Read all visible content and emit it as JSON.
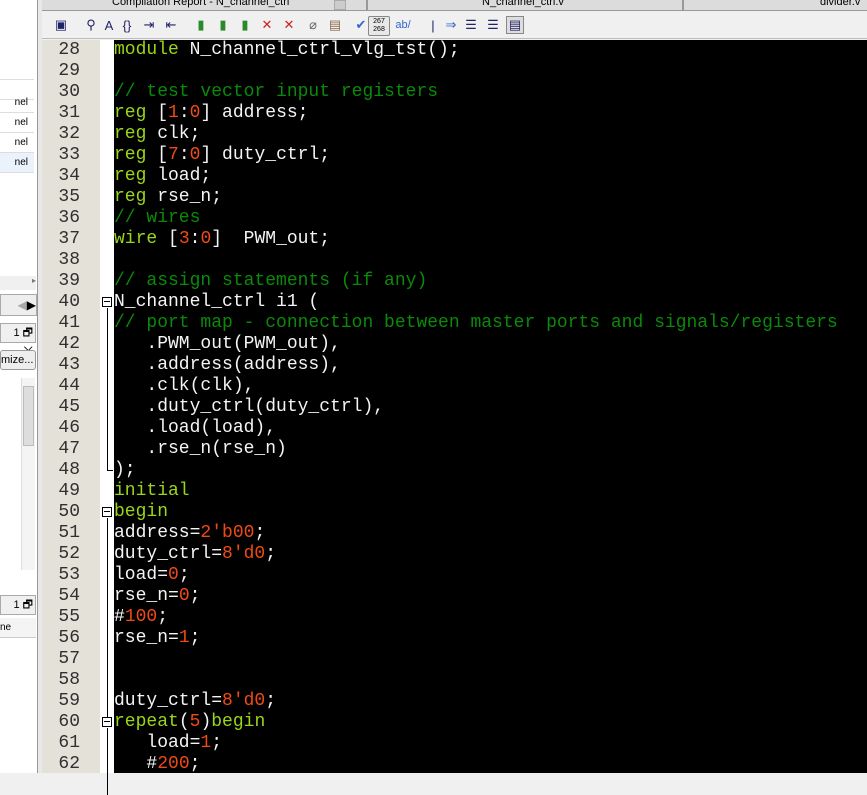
{
  "tabs": [
    {
      "label": "Compilation Report - N_channel_ctrl"
    },
    {
      "label": "N_channel_ctrl.v"
    },
    {
      "label": "divider.v"
    }
  ],
  "left_panel": {
    "items": [
      "nel",
      "nel",
      "nel",
      "nel"
    ],
    "pane_controls": "1 🗗 ✕",
    "customize_button": "mize...",
    "col_header": "ne"
  },
  "toolbar": {
    "line_number_badge": "267\n268",
    "replace_label": "ab/"
  },
  "colors": {
    "keyword": "#99d61a",
    "comment": "#0a8a0a",
    "number": "#f04a14",
    "text": "#f4f4f4"
  },
  "code": [
    {
      "n": "28",
      "t": [
        [
          "k",
          "module"
        ],
        [
          "t",
          " N_channel_ctrl_vlg_tst();"
        ]
      ]
    },
    {
      "n": "29",
      "t": []
    },
    {
      "n": "30",
      "t": [
        [
          "c",
          "// test vector input registers"
        ]
      ]
    },
    {
      "n": "31",
      "t": [
        [
          "k",
          "reg"
        ],
        [
          "t",
          " ["
        ],
        [
          "n",
          "1"
        ],
        [
          "t",
          ":"
        ],
        [
          "n",
          "0"
        ],
        [
          "t",
          "] address;"
        ]
      ]
    },
    {
      "n": "32",
      "t": [
        [
          "k",
          "reg"
        ],
        [
          "t",
          " clk;"
        ]
      ]
    },
    {
      "n": "33",
      "t": [
        [
          "k",
          "reg"
        ],
        [
          "t",
          " ["
        ],
        [
          "n",
          "7"
        ],
        [
          "t",
          ":"
        ],
        [
          "n",
          "0"
        ],
        [
          "t",
          "] duty_ctrl;"
        ]
      ]
    },
    {
      "n": "34",
      "t": [
        [
          "k",
          "reg"
        ],
        [
          "t",
          " load;"
        ]
      ]
    },
    {
      "n": "35",
      "t": [
        [
          "k",
          "reg"
        ],
        [
          "t",
          " rse_n;"
        ]
      ]
    },
    {
      "n": "36",
      "t": [
        [
          "c",
          "// wires"
        ]
      ]
    },
    {
      "n": "37",
      "t": [
        [
          "k",
          "wire"
        ],
        [
          "t",
          " ["
        ],
        [
          "n",
          "3"
        ],
        [
          "t",
          ":"
        ],
        [
          "n",
          "0"
        ],
        [
          "t",
          "]  PWM_out;"
        ]
      ]
    },
    {
      "n": "38",
      "t": []
    },
    {
      "n": "39",
      "t": [
        [
          "c",
          "// assign statements (if any)"
        ]
      ]
    },
    {
      "n": "40",
      "t": [
        [
          "t",
          "N_channel_ctrl i1 ("
        ]
      ]
    },
    {
      "n": "41",
      "t": [
        [
          "c",
          "// port map - connection between master ports and signals/registers"
        ]
      ]
    },
    {
      "n": "42",
      "t": [
        [
          "t",
          "   .PWM_out(PWM_out),"
        ]
      ]
    },
    {
      "n": "43",
      "t": [
        [
          "t",
          "   .address(address),"
        ]
      ]
    },
    {
      "n": "44",
      "t": [
        [
          "t",
          "   .clk(clk),"
        ]
      ]
    },
    {
      "n": "45",
      "t": [
        [
          "t",
          "   .duty_ctrl(duty_ctrl),"
        ]
      ]
    },
    {
      "n": "46",
      "t": [
        [
          "t",
          "   .load(load),"
        ]
      ]
    },
    {
      "n": "47",
      "t": [
        [
          "t",
          "   .rse_n(rse_n)"
        ]
      ]
    },
    {
      "n": "48",
      "t": [
        [
          "t",
          ");"
        ]
      ]
    },
    {
      "n": "49",
      "t": [
        [
          "k",
          "initial"
        ]
      ]
    },
    {
      "n": "50",
      "t": [
        [
          "k",
          "begin"
        ]
      ]
    },
    {
      "n": "51",
      "t": [
        [
          "t",
          "address="
        ],
        [
          "n",
          "2'b00"
        ],
        [
          "t",
          ";"
        ]
      ]
    },
    {
      "n": "52",
      "t": [
        [
          "t",
          "duty_ctrl="
        ],
        [
          "n",
          "8'd0"
        ],
        [
          "t",
          ";"
        ]
      ]
    },
    {
      "n": "53",
      "t": [
        [
          "t",
          "load="
        ],
        [
          "n",
          "0"
        ],
        [
          "t",
          ";"
        ]
      ]
    },
    {
      "n": "54",
      "t": [
        [
          "t",
          "rse_n="
        ],
        [
          "n",
          "0"
        ],
        [
          "t",
          ";"
        ]
      ]
    },
    {
      "n": "55",
      "t": [
        [
          "t",
          "#"
        ],
        [
          "n",
          "100"
        ],
        [
          "t",
          ";"
        ]
      ]
    },
    {
      "n": "56",
      "t": [
        [
          "t",
          "rse_n="
        ],
        [
          "n",
          "1"
        ],
        [
          "t",
          ";"
        ]
      ]
    },
    {
      "n": "57",
      "t": []
    },
    {
      "n": "58",
      "t": []
    },
    {
      "n": "59",
      "t": [
        [
          "t",
          "duty_ctrl="
        ],
        [
          "n",
          "8'd0"
        ],
        [
          "t",
          ";"
        ]
      ]
    },
    {
      "n": "60",
      "t": [
        [
          "k",
          "repeat"
        ],
        [
          "t",
          "("
        ],
        [
          "n",
          "5"
        ],
        [
          "t",
          ")"
        ],
        [
          "k",
          "begin"
        ]
      ]
    },
    {
      "n": "61",
      "t": [
        [
          "t",
          "   load="
        ],
        [
          "n",
          "1"
        ],
        [
          "t",
          ";"
        ]
      ]
    },
    {
      "n": "62",
      "t": [
        [
          "t",
          "   #"
        ],
        [
          "n",
          "200"
        ],
        [
          "t",
          ";"
        ]
      ]
    }
  ]
}
